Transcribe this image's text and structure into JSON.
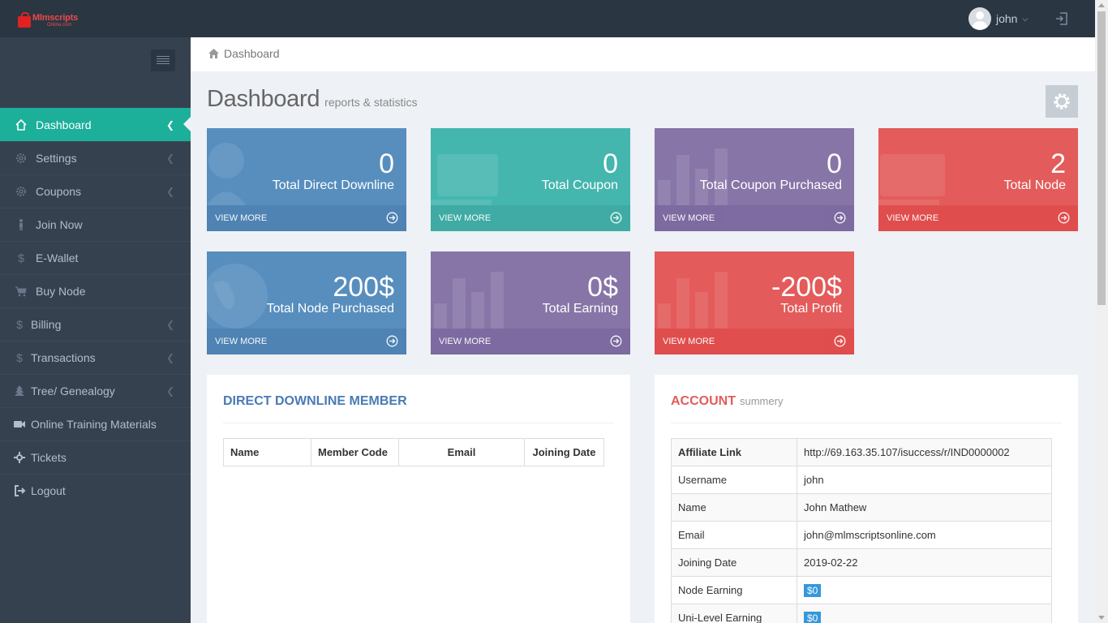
{
  "header": {
    "logo": {
      "brand": "Mlmscripts",
      "sub": "Online.com"
    },
    "username": "john"
  },
  "sidebar": {
    "items": [
      {
        "label": "Dashboard",
        "icon": "home-icon",
        "active": true,
        "arrow": true
      },
      {
        "label": "Settings",
        "icon": "gear-icon",
        "arrow": true
      },
      {
        "label": "Coupons",
        "icon": "gear-icon",
        "arrow": true
      },
      {
        "label": "Join Now",
        "icon": "person-icon",
        "arrow": false
      },
      {
        "label": "E-Wallet",
        "icon": "dollar-icon",
        "arrow": false
      },
      {
        "label": "Buy Node",
        "icon": "cart-icon",
        "arrow": false
      },
      {
        "label": "Billing",
        "icon": "dollar-icon",
        "arrow": true
      },
      {
        "label": "Transactions",
        "icon": "dollar-icon",
        "arrow": true
      },
      {
        "label": "Tree/ Genealogy",
        "icon": "tree-icon",
        "arrow": true
      },
      {
        "label": "Online Training Materials",
        "icon": "video-icon",
        "arrow": false
      },
      {
        "label": "Tickets",
        "icon": "crosshair-icon",
        "arrow": false
      },
      {
        "label": "Logout",
        "icon": "logout-icon",
        "arrow": false
      }
    ]
  },
  "breadcrumb": {
    "label": "Dashboard"
  },
  "page": {
    "title": "Dashboard",
    "subtitle": "reports & statistics"
  },
  "tiles": [
    {
      "value": "0",
      "label": "Total Direct Downline",
      "more": "VIEW MORE",
      "color": "#578ebe"
    },
    {
      "value": "0",
      "label": "Total Coupon",
      "more": "VIEW MORE",
      "color": "#44b6ae"
    },
    {
      "value": "0",
      "label": "Total Coupon Purchased",
      "more": "VIEW MORE",
      "color": "#8775a7"
    },
    {
      "value": "2",
      "label": "Total Node",
      "more": "VIEW MORE",
      "color": "#e35b5a"
    },
    {
      "value": "200$",
      "label": "Total Node Purchased",
      "more": "VIEW MORE",
      "color": "#578ebe"
    },
    {
      "value": "0$",
      "label": "Total Earning",
      "more": "VIEW MORE",
      "color": "#8775a7"
    },
    {
      "value": "-200$",
      "label": "Total Profit",
      "more": "VIEW MORE",
      "color": "#e35b5a"
    }
  ],
  "downline": {
    "title": "DIRECT DOWNLINE MEMBER",
    "columns": [
      "Name",
      "Member Code",
      "Email",
      "Joining Date"
    ]
  },
  "account": {
    "title": "ACCOUNT",
    "subtitle": "summery",
    "rows": [
      {
        "key": "Affiliate Link",
        "value": "http://69.163.35.107/isuccess/r/IND0000002"
      },
      {
        "key": "Username",
        "value": "john"
      },
      {
        "key": "Name",
        "value": "John Mathew"
      },
      {
        "key": "Email",
        "value": "john@mlmscriptsonline.com"
      },
      {
        "key": "Joining Date",
        "value": "2019-02-22"
      },
      {
        "key": "Node Earning",
        "value": "$0"
      },
      {
        "key": "Uni-Level Earning",
        "value": "$0"
      }
    ]
  },
  "colors": {
    "accent": "#1caf9a",
    "sidebar": "#364150",
    "header": "#2b3643",
    "blue": "#578ebe",
    "green": "#44b6ae",
    "purple": "#8775a7",
    "red": "#e35b5a",
    "link": "#3598dc"
  }
}
